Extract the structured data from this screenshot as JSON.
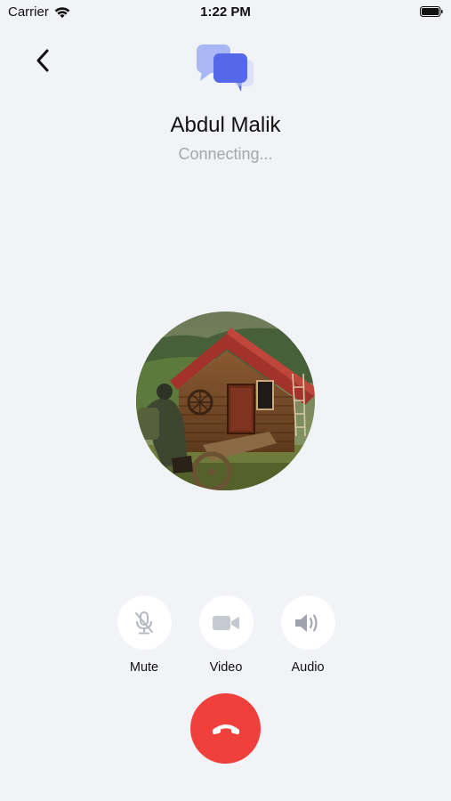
{
  "status_bar": {
    "carrier": "Carrier",
    "time": "1:22 PM",
    "icons": [
      "wifi-icon",
      "battery-icon"
    ]
  },
  "header": {
    "back_icon": "chevron-left-icon",
    "logo_icon": "chat-bubbles-icon"
  },
  "call": {
    "name": "Abdul Malik",
    "status": "Connecting..."
  },
  "controls": [
    {
      "label": "Mute",
      "icon": "microphone-muted-icon"
    },
    {
      "label": "Video",
      "icon": "video-camera-icon"
    },
    {
      "label": "Audio",
      "icon": "speaker-icon"
    }
  ],
  "end_call": {
    "icon": "hang-up-phone-icon"
  },
  "colors": {
    "background": "#f2f3f6",
    "end_call": "#f0403c",
    "logo_back": "#a9b8f5",
    "logo_front": "#5568e8",
    "control_icon": "#b5b8c2",
    "status_text": "#a5a7ad"
  }
}
